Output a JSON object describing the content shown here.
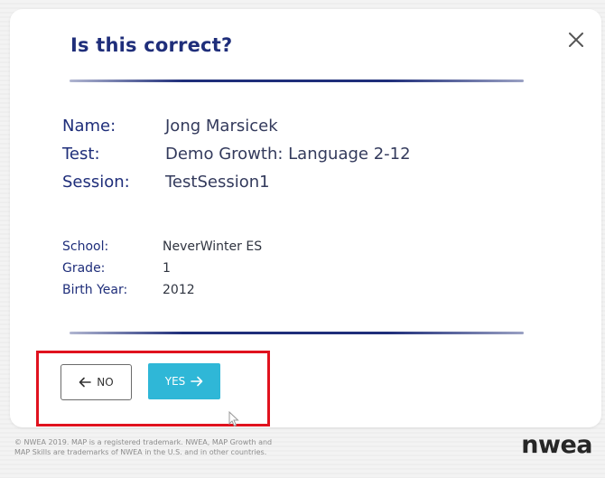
{
  "dialog": {
    "title": "Is this correct?",
    "close_icon": "close-icon",
    "fields": [
      {
        "label": "Name:",
        "value": "Jong Marsicek"
      },
      {
        "label": "Test:",
        "value": "Demo Growth: Language 2-12"
      },
      {
        "label": "Session:",
        "value": "TestSession1"
      }
    ],
    "details": [
      {
        "label": "School:",
        "value": "NeverWinter ES"
      },
      {
        "label": "Grade:",
        "value": "1"
      },
      {
        "label": "Birth Year:",
        "value": "2012"
      }
    ],
    "no_button": {
      "label": "NO",
      "icon": "arrow-left-icon"
    },
    "yes_button": {
      "label": "YES",
      "icon": "arrow-right-icon"
    }
  },
  "footer": {
    "copyright_line1": "© NWEA 2019. MAP is a registered trademark. NWEA, MAP Growth and",
    "copyright_line2": "MAP Skills are trademarks of NWEA in the U.S. and in other countries.",
    "logo": "nwea"
  },
  "colors": {
    "title": "#1f2e7a",
    "yes_button": "#2fb7d7",
    "highlight": "#e0121e"
  }
}
